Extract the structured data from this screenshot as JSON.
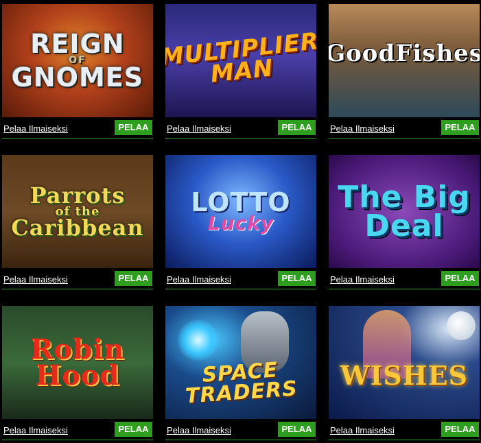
{
  "games": [
    {
      "id": "t1",
      "title": "REIGN",
      "subtitle": "OF",
      "title2": "GNOMES",
      "free_label": "Pelaa Ilmaiseksi",
      "play_label": "PELAA"
    },
    {
      "id": "t2",
      "title": "MULTIPLIER",
      "subtitle": "",
      "title2": "MAN",
      "free_label": "Pelaa Ilmaiseksi",
      "play_label": "PELAA"
    },
    {
      "id": "t3",
      "title": "GoodFishes",
      "subtitle": "",
      "title2": "",
      "free_label": "Pelaa Ilmaiseksi",
      "play_label": "PELAA"
    },
    {
      "id": "t4",
      "title": "Parrots",
      "subtitle": "of the",
      "title2": "Caribbean",
      "free_label": "Pelaa Ilmaiseksi",
      "play_label": "PELAA"
    },
    {
      "id": "t5",
      "title": "LOTTO",
      "subtitle": "Lucky",
      "title2": "",
      "free_label": "Pelaa Ilmaiseksi",
      "play_label": "PELAA"
    },
    {
      "id": "t6",
      "title": "The Big",
      "subtitle": "",
      "title2": "Deal",
      "free_label": "Pelaa Ilmaiseksi",
      "play_label": "PELAA"
    },
    {
      "id": "t7",
      "title": "Robin",
      "subtitle": "",
      "title2": "Hood",
      "free_label": "Pelaa Ilmaiseksi",
      "play_label": "PELAA"
    },
    {
      "id": "t8",
      "title": "SPACE",
      "subtitle": "",
      "title2": "TRADERS",
      "free_label": "Pelaa Ilmaiseksi",
      "play_label": "PELAA"
    },
    {
      "id": "t9",
      "title": "WISHES",
      "subtitle": "",
      "title2": "",
      "free_label": "Pelaa Ilmaiseksi",
      "play_label": "PELAA"
    }
  ],
  "colors": {
    "play_button": "#2e9e1e",
    "divider": "#2fa32f",
    "background": "#000000"
  }
}
